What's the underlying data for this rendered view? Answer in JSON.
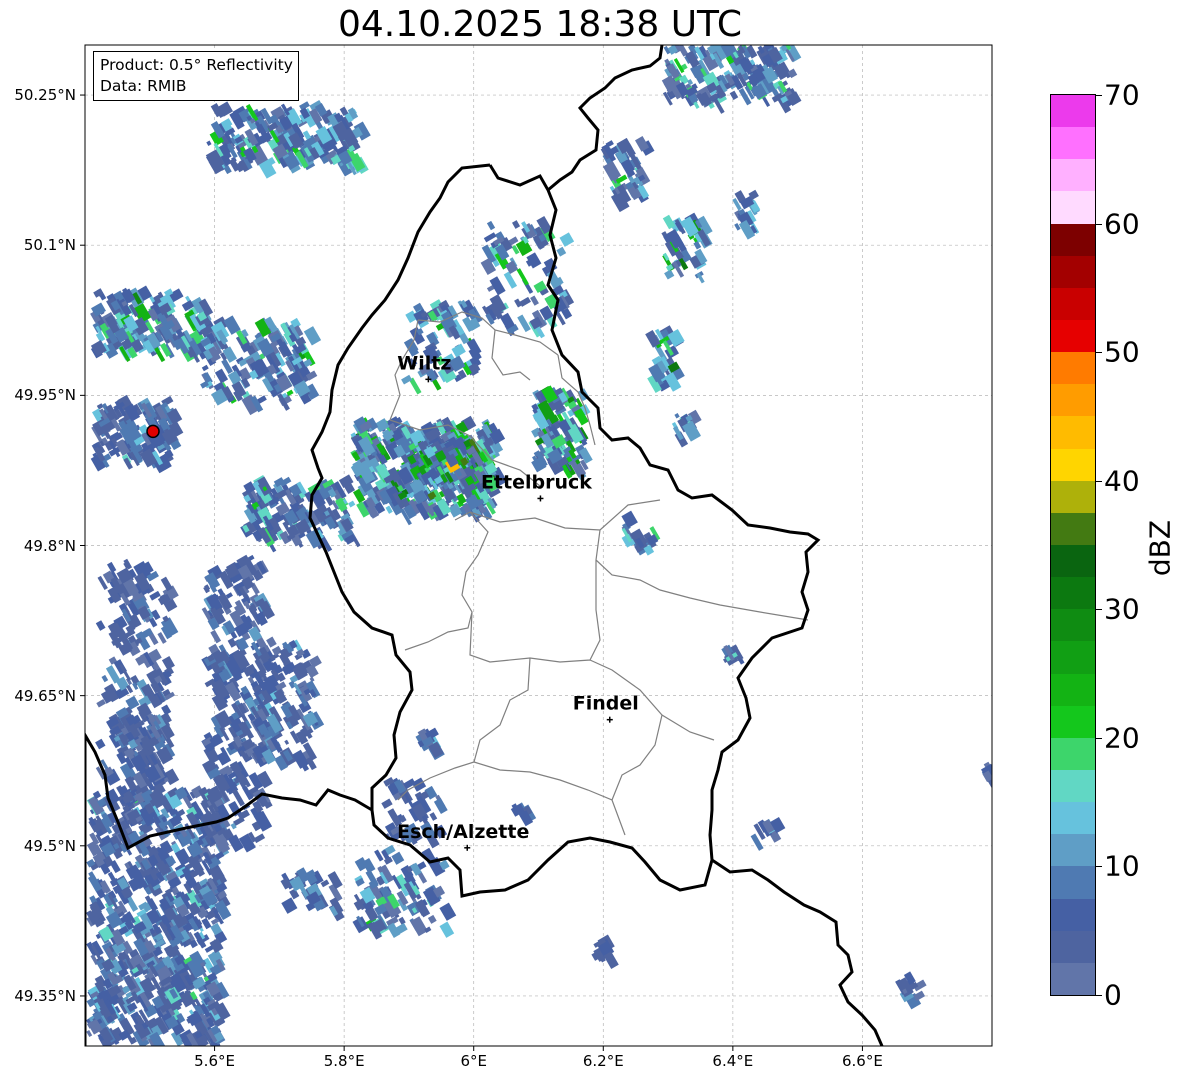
{
  "title": "04.10.2025 18:38 UTC",
  "info": {
    "product": "Product: 0.5° Reflectivity",
    "data": "Data: RMIB"
  },
  "map": {
    "lon_range": [
      5.4,
      6.8
    ],
    "lat_range": [
      49.3,
      50.3
    ],
    "lon_ticks": [
      {
        "value": 5.6,
        "label": "5.6°E"
      },
      {
        "value": 5.8,
        "label": "5.8°E"
      },
      {
        "value": 6.0,
        "label": "6°E"
      },
      {
        "value": 6.2,
        "label": "6.2°E"
      },
      {
        "value": 6.4,
        "label": "6.4°E"
      },
      {
        "value": 6.6,
        "label": "6.6°E"
      }
    ],
    "lat_ticks": [
      {
        "value": 49.35,
        "label": "49.35°N"
      },
      {
        "value": 49.5,
        "label": "49.5°N"
      },
      {
        "value": 49.65,
        "label": "49.65°N"
      },
      {
        "value": 49.8,
        "label": "49.8°N"
      },
      {
        "value": 49.95,
        "label": "49.95°N"
      },
      {
        "value": 50.1,
        "label": "50.1°N"
      },
      {
        "value": 50.25,
        "label": "50.25°N"
      }
    ],
    "cities": [
      {
        "name": "Wiltz",
        "lon": 5.93,
        "lat": 49.966
      },
      {
        "name": "Ettelbruck",
        "lon": 6.103,
        "lat": 49.847
      },
      {
        "name": "Findel",
        "lon": 6.21,
        "lat": 49.626
      },
      {
        "name": "Esch/Alzette",
        "lon": 5.99,
        "lat": 49.498
      }
    ],
    "radar_site": {
      "lon": 5.505,
      "lat": 49.914
    }
  },
  "colorbar": {
    "label": "dBZ",
    "min": 0,
    "max": 70,
    "ticks": [
      "0",
      "10",
      "20",
      "30",
      "40",
      "50",
      "60",
      "70"
    ],
    "colors": [
      "#6175a9",
      "#4e64a0",
      "#4560a4",
      "#4f7ab2",
      "#5f9ec6",
      "#66c2dd",
      "#61d7c4",
      "#3dd56b",
      "#14c71c",
      "#13b314",
      "#119f14",
      "#0f8c12",
      "#0c7910",
      "#0a6510",
      "#437a12",
      "#aeb10a",
      "#ffd500",
      "#ffbb00",
      "#ff9c00",
      "#ff7b00",
      "#e60000",
      "#c90000",
      "#a30000",
      "#7d0000",
      "#ffdaff",
      "#ffb0ff",
      "#ff70ff",
      "#ec3aec"
    ]
  }
}
